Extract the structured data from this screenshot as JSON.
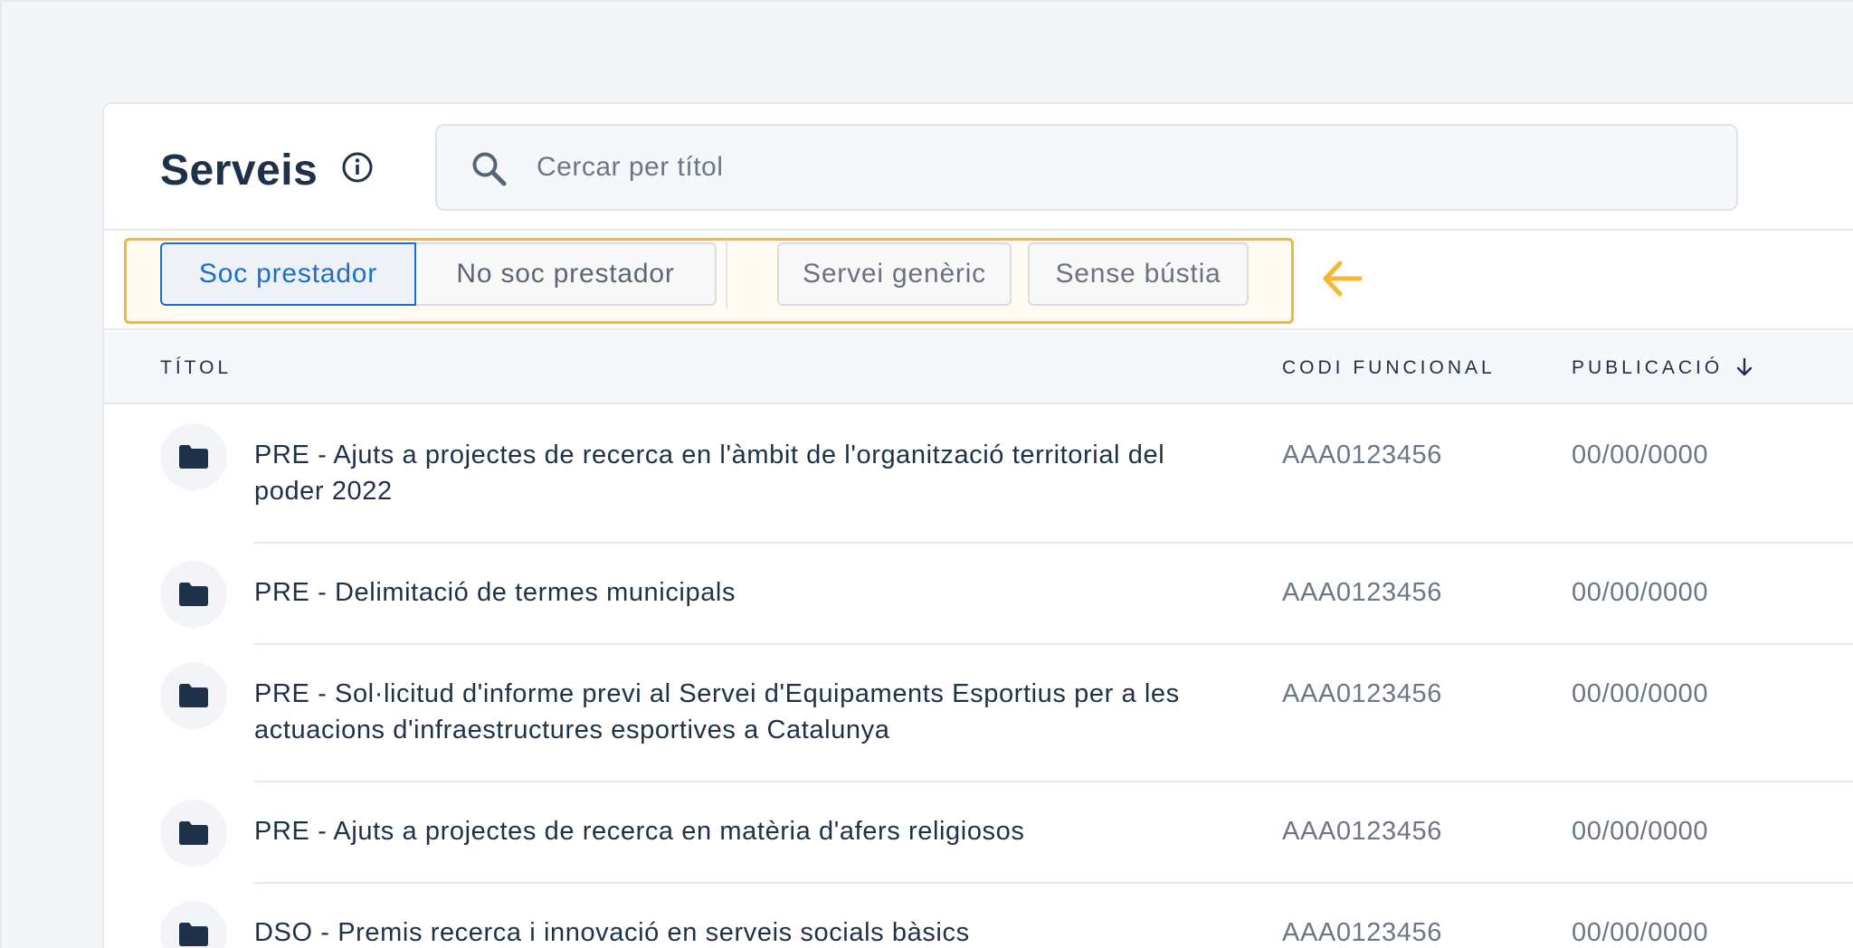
{
  "header": {
    "title": "Serveis",
    "search_placeholder": "Cercar per títol"
  },
  "filters": {
    "segments": [
      {
        "label": "Soc prestador",
        "active": true
      },
      {
        "label": "No soc prestador",
        "active": false
      }
    ],
    "chips": [
      {
        "label": "Servei genèric"
      },
      {
        "label": "Sense bústia"
      }
    ],
    "highlight_color": "#f5b731",
    "accent_color": "#1a6fd1"
  },
  "table": {
    "columns": {
      "title": "TÍTOL",
      "code": "CODI FUNCIONAL",
      "date": "PUBLICACIÓ"
    },
    "sort": {
      "column": "date",
      "direction": "descending",
      "icon": "arrow-down-icon"
    },
    "rows": [
      {
        "icon": "folder-icon",
        "title": "PRE - Ajuts a projectes de recerca en l'àmbit de l'organització territorial del poder 2022",
        "code": "AAA0123456",
        "date": "00/00/0000"
      },
      {
        "icon": "folder-icon",
        "title": "PRE - Delimitació de termes municipals",
        "code": "AAA0123456",
        "date": "00/00/0000"
      },
      {
        "icon": "folder-icon",
        "title": "PRE - Sol·licitud d'informe previ al Servei d'Equipaments Esportius per a les actuacions d'infraestructures esportives a Catalunya",
        "code": "AAA0123456",
        "date": "00/00/0000"
      },
      {
        "icon": "folder-icon",
        "title": "PRE - Ajuts a projectes de recerca en matèria d'afers religiosos",
        "code": "AAA0123456",
        "date": "00/00/0000"
      },
      {
        "icon": "folder-icon",
        "title": "DSO - Premis recerca i innovació en serveis socials bàsics",
        "code": "AAA0123456",
        "date": "00/00/0000"
      }
    ]
  }
}
